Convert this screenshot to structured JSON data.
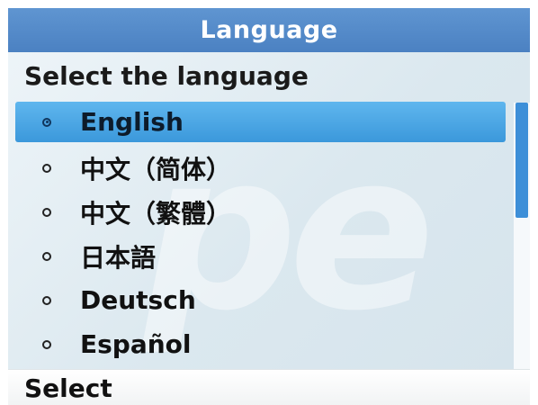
{
  "screen": {
    "title": "Language",
    "subtitle": "Select the language"
  },
  "languages": [
    {
      "label": "English",
      "selected": true
    },
    {
      "label": "中文（简体）",
      "selected": false
    },
    {
      "label": "中文（繁體）",
      "selected": false
    },
    {
      "label": "日本語",
      "selected": false
    },
    {
      "label": "Deutsch",
      "selected": false
    },
    {
      "label": "Español",
      "selected": false
    }
  ],
  "softkeys": {
    "left": "Select"
  },
  "colors": {
    "title_bar": "#4b81c2",
    "selection": "#3b98db",
    "scroll_thumb": "#3d8fd8"
  }
}
